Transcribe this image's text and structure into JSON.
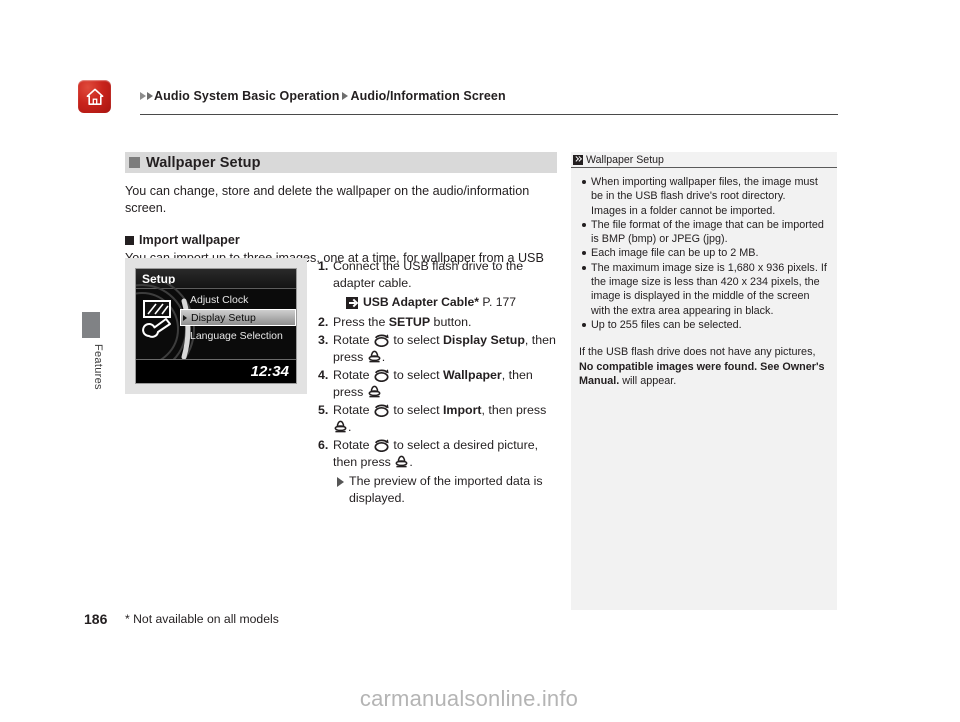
{
  "header": {
    "home_icon": "home-icon",
    "breadcrumb": [
      "Audio System Basic Operation",
      "Audio/Information Screen"
    ]
  },
  "side_tab": {
    "label": "Features"
  },
  "main": {
    "section_title": "Wallpaper Setup",
    "intro": "You can change, store and delete the wallpaper on the audio/information screen.",
    "sub_title": "Import wallpaper",
    "sub_intro": "You can import up to three images, one at a time, for wallpaper from a USB flash drive."
  },
  "device_screen": {
    "title": "Setup",
    "items": [
      {
        "label": "Adjust Clock",
        "selected": false
      },
      {
        "label": "Display Setup",
        "selected": true
      },
      {
        "label": "Language Selection",
        "selected": false
      }
    ],
    "clock": "12:34",
    "icon": "display-wrench-icon"
  },
  "steps": [
    {
      "num": "1.",
      "pre": "Connect the USB flash drive to the adapter cable.",
      "reference": {
        "icon": "jump-reference-icon",
        "label": "USB Adapter Cable*",
        "page": "P. 177"
      }
    },
    {
      "num": "2.",
      "parts": [
        {
          "t": "Press the ",
          "b": false
        },
        {
          "t": "SETUP",
          "b": true
        },
        {
          "t": " button.",
          "b": false
        }
      ]
    },
    {
      "num": "3.",
      "parts": [
        {
          "t": "Rotate ",
          "b": false
        },
        {
          "icon": "rotate-knob-icon"
        },
        {
          "t": " to select ",
          "b": false
        },
        {
          "t": "Display Setup",
          "b": true
        },
        {
          "t": ", then press ",
          "b": false
        },
        {
          "icon": "press-knob-icon"
        },
        {
          "t": ".",
          "b": false
        }
      ]
    },
    {
      "num": "4.",
      "parts": [
        {
          "t": "Rotate ",
          "b": false
        },
        {
          "icon": "rotate-knob-icon"
        },
        {
          "t": " to select ",
          "b": false
        },
        {
          "t": "Wallpaper",
          "b": true
        },
        {
          "t": ", then press ",
          "b": false
        },
        {
          "icon": "press-knob-icon"
        },
        {
          "t": "",
          "b": false
        }
      ]
    },
    {
      "num": "5.",
      "parts": [
        {
          "t": "Rotate ",
          "b": false
        },
        {
          "icon": "rotate-knob-icon"
        },
        {
          "t": " to select ",
          "b": false
        },
        {
          "t": "Import",
          "b": true
        },
        {
          "t": ", then press ",
          "b": false
        },
        {
          "icon": "press-knob-icon"
        },
        {
          "t": ".",
          "b": false
        }
      ]
    },
    {
      "num": "6.",
      "parts": [
        {
          "t": "Rotate ",
          "b": false
        },
        {
          "icon": "rotate-knob-icon"
        },
        {
          "t": " to select a desired picture, then press ",
          "b": false
        },
        {
          "icon": "press-knob-icon"
        },
        {
          "t": ".",
          "b": false
        }
      ],
      "result": "The preview of the imported data is displayed."
    }
  ],
  "side_panel": {
    "title": "Wallpaper Setup",
    "title_icon": "double-arrow-icon",
    "bullets": [
      "When importing wallpaper files, the image must be in the USB flash drive's root directory.\nImages in a folder cannot be imported.",
      "The file format of the image that can be imported is BMP (bmp) or JPEG (jpg).",
      "Each image file can be up to 2 MB.",
      "The maximum image size is 1,680 x 936 pixels. If the image size is less than 420 x 234 pixels, the image is displayed in the middle of the screen with the extra area appearing in black.",
      "Up to 255 files can be selected."
    ],
    "note": {
      "lead": "If the USB flash drive does not have any pictures, ",
      "bold": "No compatible images were found. See Owner's Manual.",
      "tail": " will appear."
    }
  },
  "footer": {
    "page_number": "186",
    "footnote": "* Not available on all models",
    "watermark": "carmanualsonline.info"
  }
}
